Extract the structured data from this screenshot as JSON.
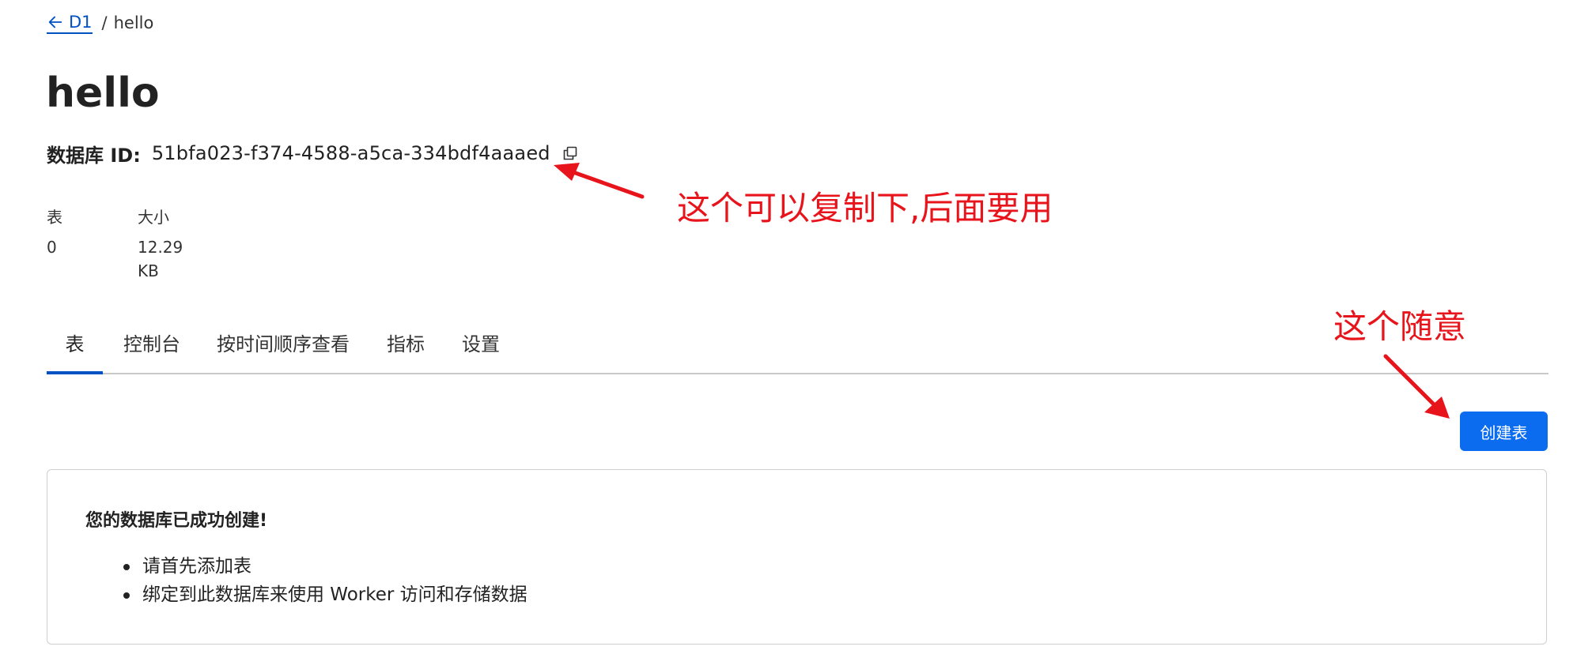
{
  "breadcrumb": {
    "parent": "D1",
    "separator": "/",
    "current": "hello"
  },
  "page": {
    "title": "hello"
  },
  "database": {
    "id_label": "数据库 ID:",
    "id_value": "51bfa023-f374-4588-a5ca-334bdf4aaaed"
  },
  "stats": [
    {
      "label": "表",
      "value": "0"
    },
    {
      "label": "大小",
      "value": "12.29 KB"
    }
  ],
  "tabs": [
    {
      "label": "表",
      "active": true
    },
    {
      "label": "控制台",
      "active": false
    },
    {
      "label": "按时间顺序查看",
      "active": false
    },
    {
      "label": "指标",
      "active": false
    },
    {
      "label": "设置",
      "active": false
    }
  ],
  "actions": {
    "create_table": "创建表"
  },
  "notice": {
    "title": "您的数据库已成功创建!",
    "items": [
      "请首先添加表",
      "绑定到此数据库来使用 Worker 访问和存储数据"
    ]
  },
  "annotations": {
    "copy_hint": "这个可以复制下,后面要用",
    "any_hint": "这个随意"
  },
  "colors": {
    "accent": "#0051c3",
    "button": "#0b6cf0",
    "annotation": "#e8141b"
  },
  "icons": {
    "back": "arrow-left-icon",
    "copy": "copy-icon"
  }
}
